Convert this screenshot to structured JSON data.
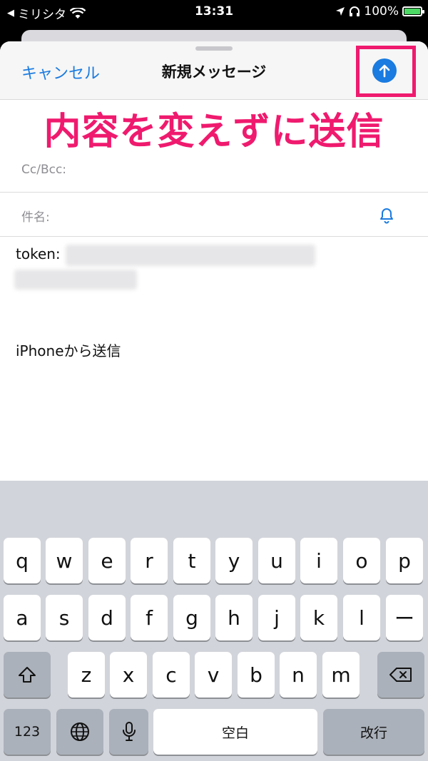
{
  "status_bar": {
    "carrier": "ミリシタ",
    "back_indicator": "◀",
    "time": "13:31",
    "battery": "100%"
  },
  "compose": {
    "cancel_label": "キャンセル",
    "title": "新規メッセージ",
    "cc_bcc_label": "Cc/Bcc:",
    "subject_label": "件名:",
    "body_token_label": "token:",
    "signature": "iPhoneから送信"
  },
  "annotation": {
    "caption": "内容を変えずに送信",
    "color": "#ef1a6e"
  },
  "keyboard": {
    "row1": [
      "q",
      "w",
      "e",
      "r",
      "t",
      "y",
      "u",
      "i",
      "o",
      "p"
    ],
    "row2": [
      "a",
      "s",
      "d",
      "f",
      "g",
      "h",
      "j",
      "k",
      "l",
      "ー"
    ],
    "row3": [
      "z",
      "x",
      "c",
      "v",
      "b",
      "n",
      "m"
    ],
    "numbers_label": "123",
    "space_label": "空白",
    "return_label": "改行"
  },
  "colors": {
    "accent": "#1a7be0",
    "battery_fill": "#4cd964"
  }
}
